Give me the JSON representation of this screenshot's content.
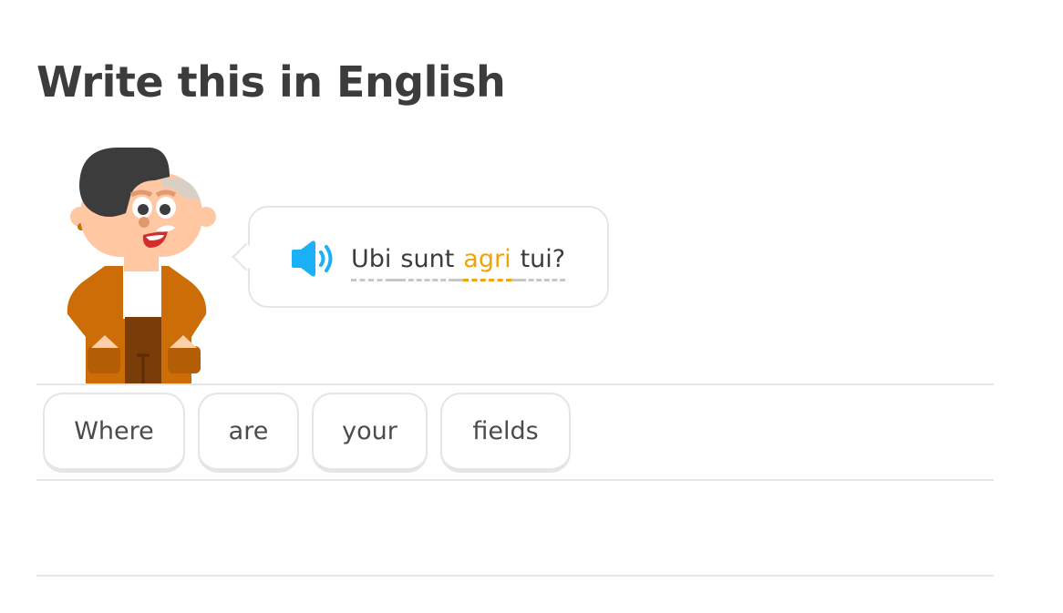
{
  "exercise": {
    "title": "Write this in English",
    "prompt_words": [
      {
        "text": "Ubi",
        "highlighted": false
      },
      {
        "text": "sunt",
        "highlighted": false
      },
      {
        "text": "agri",
        "highlighted": true
      },
      {
        "text": "tui?",
        "highlighted": false
      }
    ],
    "audio_icon": "speaker-icon",
    "highlight_color": "#f2a20a",
    "accent_color": "#1cb0f6"
  },
  "answer": {
    "tiles": [
      "Where",
      "are",
      "your",
      "fields"
    ]
  }
}
